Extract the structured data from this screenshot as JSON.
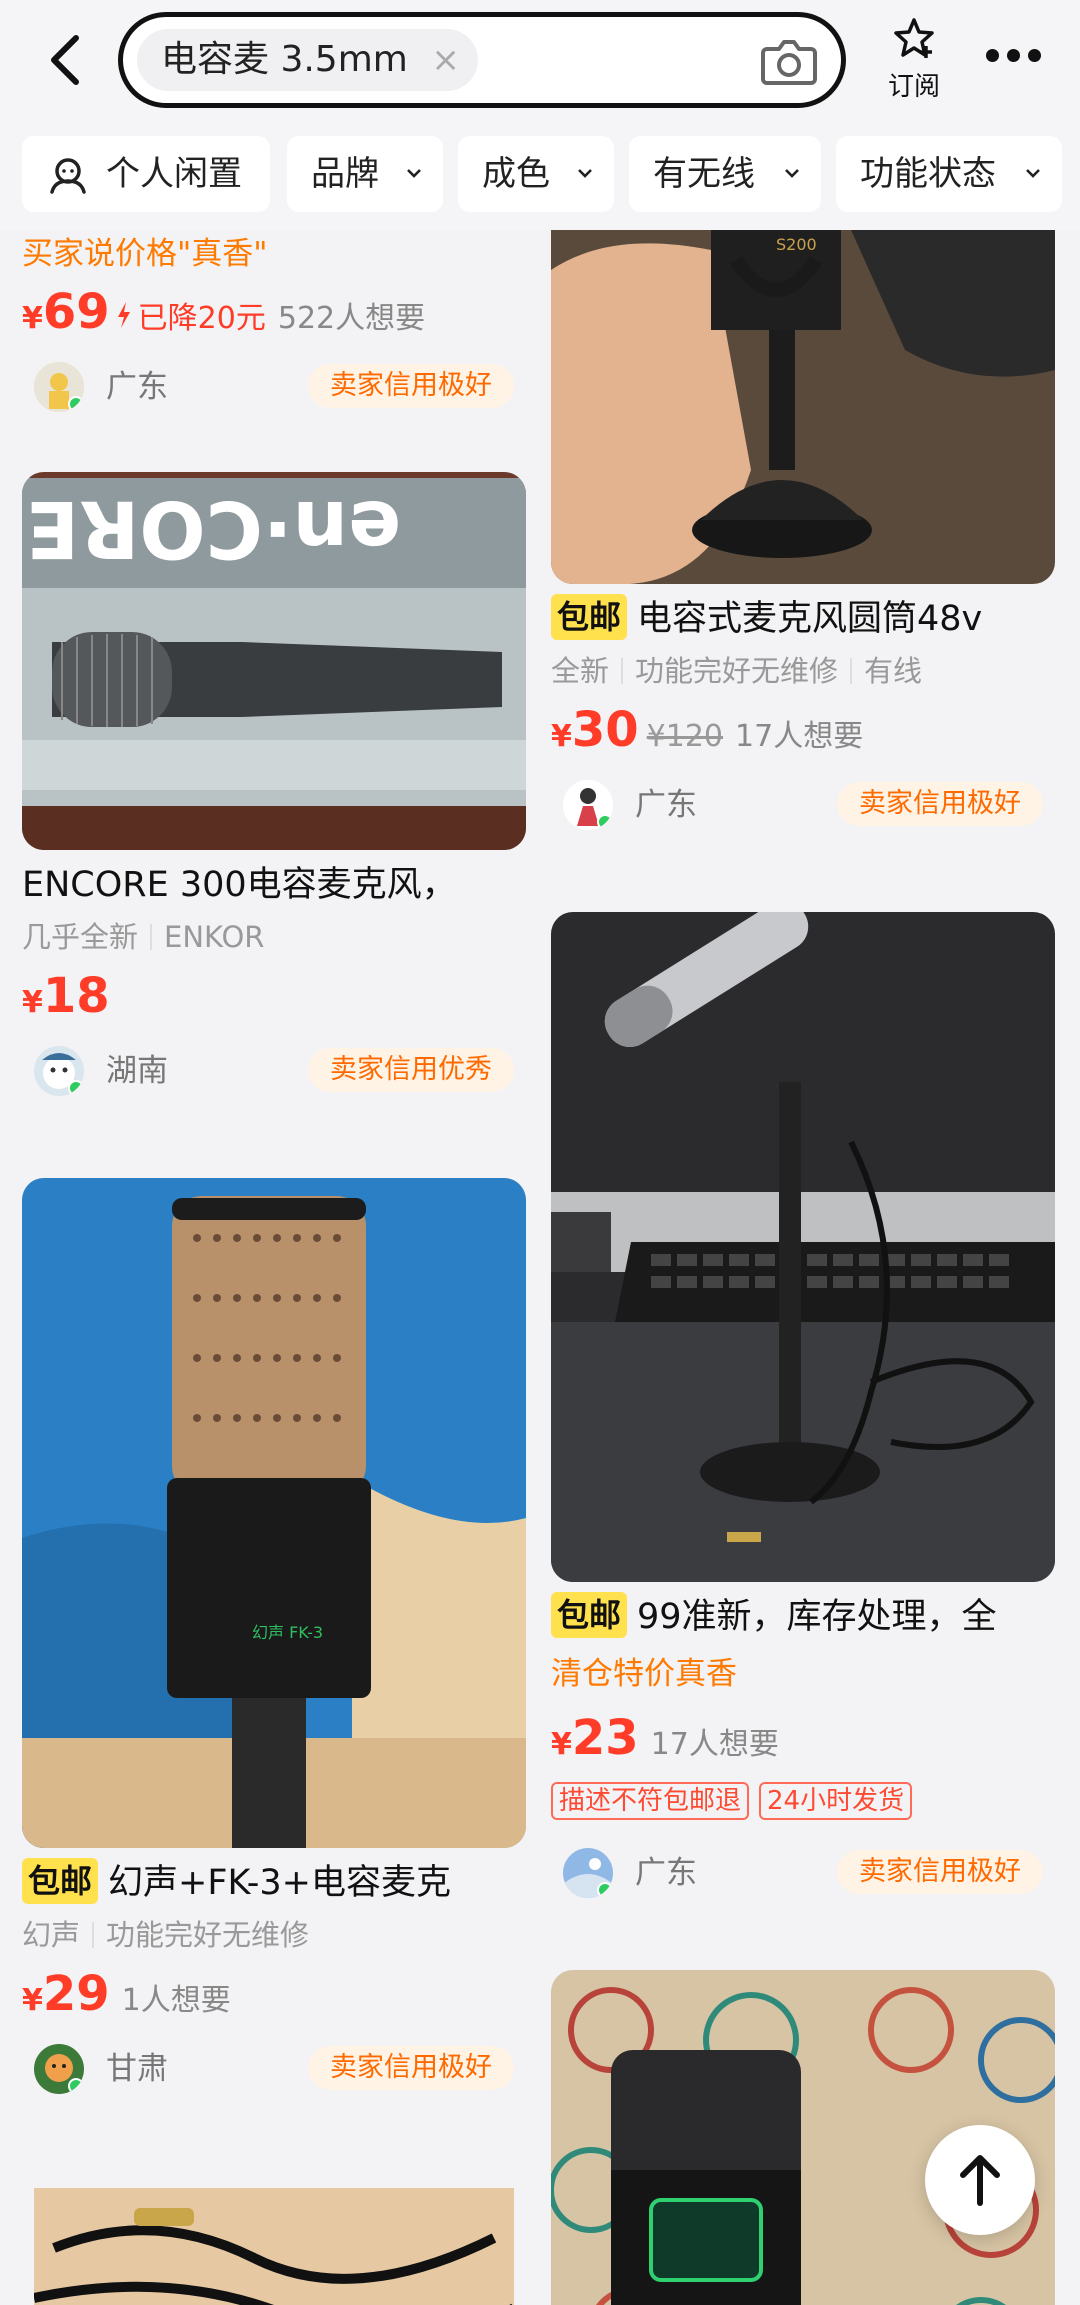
{
  "header": {
    "search_query": "电容麦 3.5mm",
    "clear_symbol": "×",
    "subscribe_label": "订阅"
  },
  "filters": [
    {
      "label": "个人闲置",
      "icon": "person-icon"
    },
    {
      "label": "品牌",
      "icon": "chevron-down-icon"
    },
    {
      "label": "成色",
      "icon": "chevron-down-icon"
    },
    {
      "label": "有无线",
      "icon": "chevron-down-icon"
    },
    {
      "label": "功能状态",
      "icon": "chevron-down-icon"
    }
  ],
  "items": {
    "l1": {
      "hint": "买家说价格\"真香\"",
      "price": "69",
      "drop": "已降20元",
      "want": "522人想要",
      "location": "广东",
      "credit": "卖家信用极好"
    },
    "l2": {
      "title": "ENCORE 300电容麦克风，",
      "attrs": [
        "几乎全新",
        "ENKOR"
      ],
      "price": "18",
      "location": "湖南",
      "credit": "卖家信用优秀",
      "image_text": "en·CORE"
    },
    "l3": {
      "badge": "包邮",
      "title": "幻声+FK-3+电容麦克",
      "attrs": [
        "幻声",
        "功能完好无维修"
      ],
      "price": "29",
      "want": "1人想要",
      "location": "甘肃",
      "credit": "卖家信用极好",
      "image_text": "幻声 FK-3"
    },
    "r1": {
      "badge": "包邮",
      "title": "电容式麦克风圆筒48v",
      "attrs": [
        "全新",
        "功能完好无维修",
        "有线"
      ],
      "price": "30",
      "original_price": "¥120",
      "want": "17人想要",
      "location": "广东",
      "credit": "卖家信用极好",
      "image_text": "S200"
    },
    "r2": {
      "badge": "包邮",
      "title": "99准新，库存处理，全",
      "hint": "清仓特价真香",
      "price": "23",
      "want": "17人想要",
      "tags": [
        "描述不符包邮退",
        "24小时发货"
      ],
      "location": "广东",
      "credit": "卖家信用极好"
    }
  },
  "currency": "¥",
  "colors": {
    "price": "#ff3c28",
    "hint": "#ff7a00",
    "badge": "#ffe14d",
    "credit_bg": "#fff3e6",
    "online": "#2ecc5f"
  }
}
